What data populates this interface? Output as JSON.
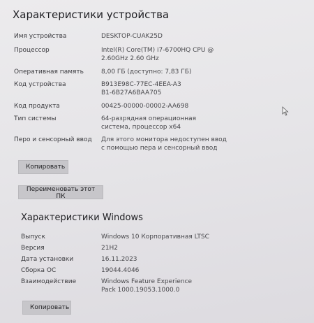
{
  "device": {
    "title": "Характеристики устройства",
    "rows": [
      {
        "label": "Имя устройства",
        "value": "DESKTOP-CUAK25D"
      },
      {
        "label": "Процессор",
        "value": "Intel(R) Core(TM) i7-6700HQ CPU @ 2.60GHz   2.60 GHz"
      },
      {
        "label": "Оперативная память",
        "value": "8,00 ГБ (доступно: 7,83 ГБ)"
      },
      {
        "label": "Код устройства",
        "value": "B913E98C-77EC-4EEA-A3B1-6B27A6BAA705"
      },
      {
        "label": "Код продукта",
        "value": "00425-00000-00002-AA698"
      },
      {
        "label": "Тип системы",
        "value": "64-разрядная операционная система, процессор x64"
      },
      {
        "label": "Перо и сенсорный ввод",
        "value": "Для этого монитора недоступен ввод с помощью пера и сенсорный ввод"
      }
    ],
    "copy_label": "Копировать",
    "rename_label": "Переименовать этот ПК"
  },
  "windows": {
    "title": "Характеристики Windows",
    "rows": [
      {
        "label": "Выпуск",
        "value": "Windows 10 Корпоративная LTSC"
      },
      {
        "label": "Версия",
        "value": "21H2"
      },
      {
        "label": "Дата установки",
        "value": "16.11.2023"
      },
      {
        "label": "Сборка ОС",
        "value": "19044.4046"
      },
      {
        "label": "Взаимодействие",
        "value": "Windows Feature Experience Pack 1000.19053.1000.0"
      }
    ],
    "copy_label": "Копировать"
  }
}
